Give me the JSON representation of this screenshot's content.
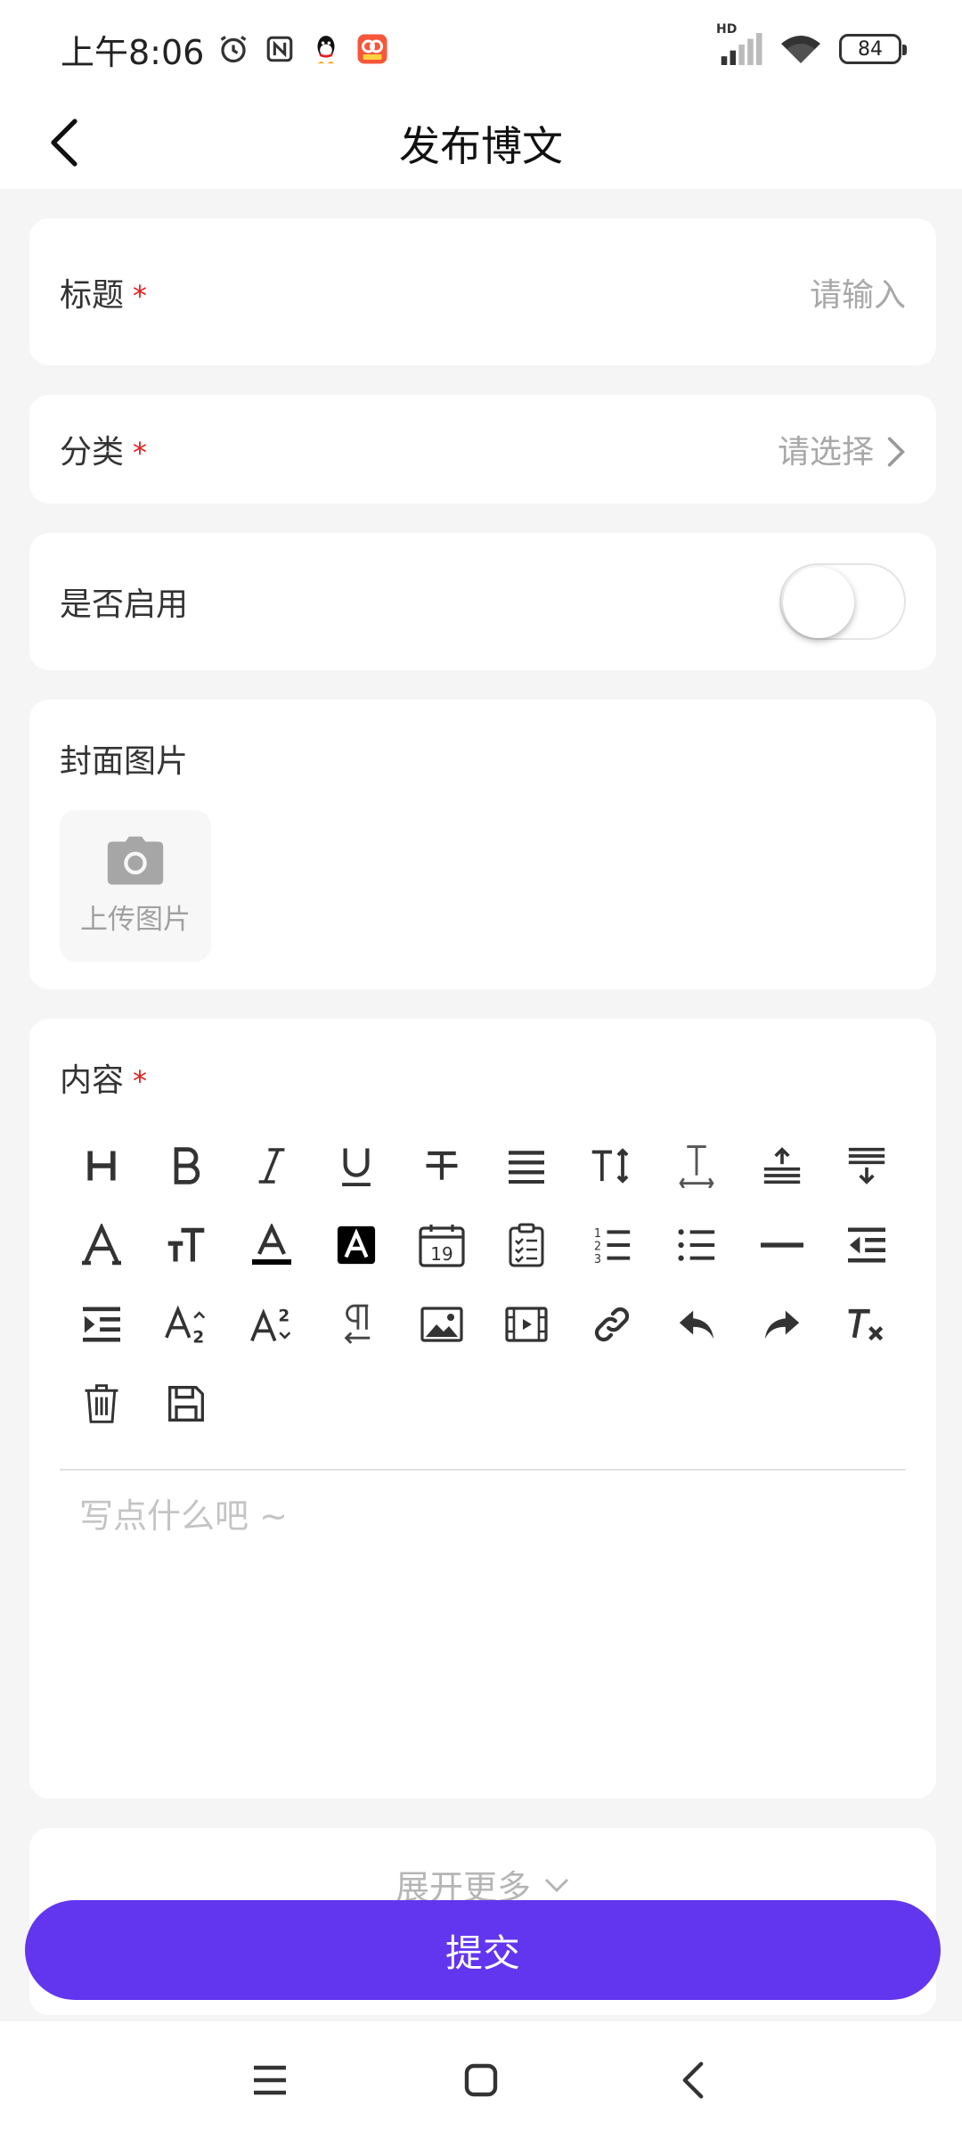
{
  "status_bar": {
    "time": "上午8:06",
    "network": "HD",
    "battery": "84",
    "icons": [
      "alarm-icon",
      "nfc-icon",
      "qq-icon",
      "app-badge-icon",
      "signal-icon",
      "wifi-icon",
      "battery-icon"
    ]
  },
  "nav": {
    "title": "发布博文",
    "back_icon": "chevron-left-icon"
  },
  "form": {
    "title": {
      "label": "标题",
      "required": "*",
      "placeholder": "请输入"
    },
    "category": {
      "label": "分类",
      "required": "*",
      "placeholder": "请选择"
    },
    "enabled": {
      "label": "是否启用",
      "value": false
    },
    "cover": {
      "label": "封面图片",
      "upload_label": "上传图片"
    },
    "content": {
      "label": "内容",
      "required": "*",
      "placeholder": "写点什么吧 ~",
      "toolbar": [
        "heading-icon",
        "bold-icon",
        "italic-icon",
        "underline-icon",
        "strikethrough-icon",
        "align-justify-icon",
        "line-height-icon",
        "letter-spacing-icon",
        "spacing-above-icon",
        "spacing-below-icon",
        "font-icon",
        "font-size-icon",
        "text-color-icon",
        "background-color-icon",
        "date-icon",
        "clipboard-list-icon",
        "ordered-list-icon",
        "unordered-list-icon",
        "horizontal-rule-icon",
        "outdent-icon",
        "indent-icon",
        "subscript-icon",
        "superscript-icon",
        "paragraph-icon",
        "image-icon",
        "video-icon",
        "link-icon",
        "undo-icon",
        "redo-icon",
        "clear-format-icon",
        "trash-icon",
        "save-icon"
      ]
    },
    "expand_more": "展开更多",
    "submit": "提交"
  },
  "colors": {
    "primary": "#6236ee",
    "required": "#e02020",
    "background": "#f5f5f5"
  }
}
